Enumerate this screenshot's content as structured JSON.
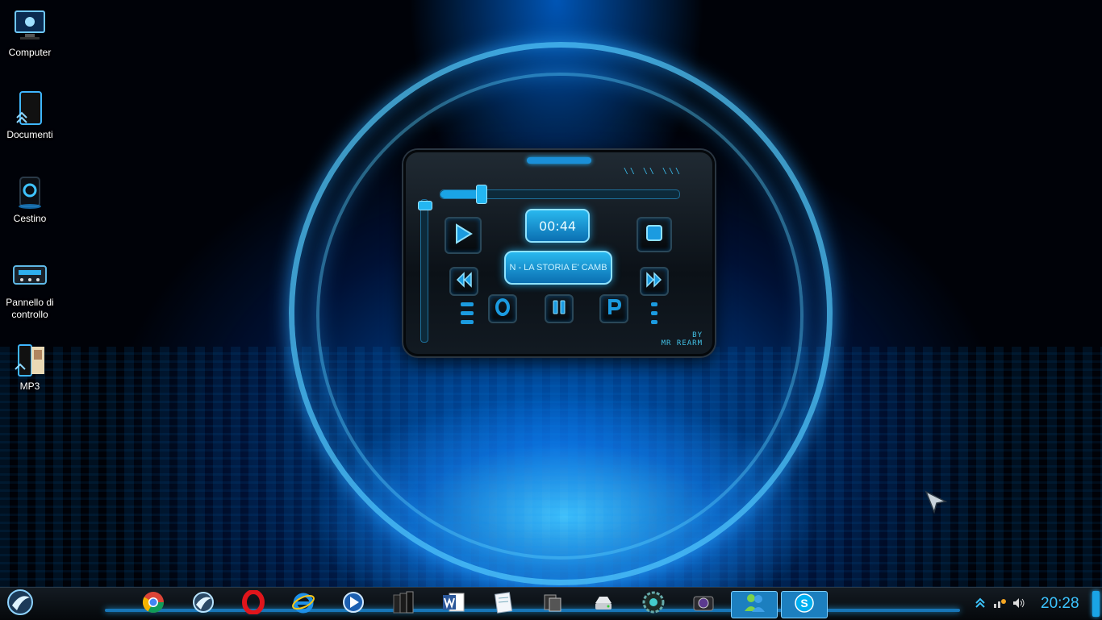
{
  "desktop": {
    "icons": [
      {
        "label": "Computer"
      },
      {
        "label": "Documenti"
      },
      {
        "label": "Cestino"
      },
      {
        "label": "Pannello di controllo"
      },
      {
        "label": "MP3"
      }
    ]
  },
  "player": {
    "time": "00:44",
    "track_title": "N - LA STORIA E' CAMB",
    "credit_line1": "BY",
    "credit_line2": "MR REARM",
    "seek_fraction": 0.17,
    "volume_fraction": 0.0,
    "buttons": [
      "play-icon",
      "stop-icon",
      "previous-icon",
      "next-icon",
      "open-icon",
      "pause-icon",
      "playlist-icon"
    ]
  },
  "taskbar": {
    "start_icon": "start-orb-icon",
    "apps": [
      "chrome-icon",
      "media-orb-icon",
      "opera-icon",
      "internet-explorer-icon",
      "media-player-icon",
      "file-manager-icon",
      "word-icon",
      "notepad-icon",
      "folders-icon",
      "network-drive-icon",
      "gear-icon",
      "camera-icon",
      "messenger-icon",
      "skype-icon"
    ],
    "tray": {
      "icons": [
        "chevron-up-icon",
        "network-icon",
        "speaker-icon"
      ],
      "clock": "20:28"
    }
  },
  "colors": {
    "accent": "#1aa4e6",
    "glow": "#29b4ff",
    "clock": "#3cc4ff"
  }
}
